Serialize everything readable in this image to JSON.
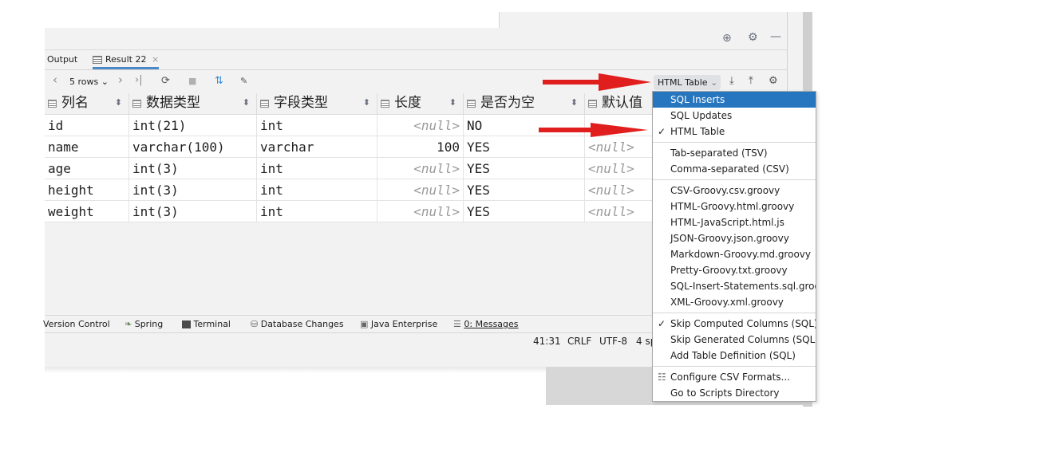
{
  "colors": {
    "accent": "#2675bf",
    "arrow": "#e01e1e",
    "null_text": "#9a9a9a"
  },
  "top_icons": [
    "crosshair-icon",
    "gear-icon",
    "minimize-icon"
  ],
  "tabs": [
    {
      "label": "Output"
    },
    {
      "label": "Result 22",
      "icon": "table-icon",
      "close": "×"
    }
  ],
  "toolbar": {
    "prev": "‹",
    "rows": "5 rows",
    "rows_caret": "⌄",
    "next": "›",
    "last": "›|",
    "refresh": "⟳",
    "stop": "■",
    "compare": "⇅",
    "pin": "📌",
    "export_format": "HTML Table",
    "export_caret": "⌄",
    "download": "⤓",
    "upload": "⤒",
    "settings": "⚙"
  },
  "grid": {
    "headers": [
      "列名",
      "数据类型",
      "字段类型",
      "长度",
      "是否为空",
      "默认值"
    ],
    "sort_glyph": "⬍",
    "rows": [
      [
        "id",
        "int(21)",
        "int",
        "<null>",
        "NO",
        ""
      ],
      [
        "name",
        "varchar(100)",
        "varchar",
        "100",
        "YES",
        "<null>"
      ],
      [
        "age",
        "int(3)",
        "int",
        "<null>",
        "YES",
        "<null>"
      ],
      [
        "height",
        "int(3)",
        "int",
        "<null>",
        "YES",
        "<null>"
      ],
      [
        "weight",
        "int(3)",
        "int",
        "<null>",
        "YES",
        "<null>"
      ]
    ]
  },
  "bottom_tabs": [
    {
      "label": "Version Control",
      "icon": ""
    },
    {
      "label": "Spring",
      "icon": "spring-icon"
    },
    {
      "label": "Terminal",
      "icon": "terminal-icon"
    },
    {
      "label": "Database Changes",
      "icon": "database-icon"
    },
    {
      "label": "Java Enterprise",
      "icon": "java-enterprise-icon"
    },
    {
      "label": "0: Messages",
      "icon": "messages-icon"
    }
  ],
  "status": {
    "position": "41:31",
    "line_sep": "CRLF",
    "encoding": "UTF-8",
    "indent": "4 sp"
  },
  "menu": {
    "items": [
      {
        "label": "SQL Inserts",
        "selected": true,
        "checked": false
      },
      {
        "label": "SQL Updates",
        "checked": false
      },
      {
        "label": "HTML Table",
        "checked": true
      },
      {
        "sep": true
      },
      {
        "label": "Tab-separated (TSV)",
        "checked": false
      },
      {
        "label": "Comma-separated (CSV)",
        "checked": false
      },
      {
        "sep": true
      },
      {
        "label": "CSV-Groovy.csv.groovy"
      },
      {
        "label": "HTML-Groovy.html.groovy"
      },
      {
        "label": "HTML-JavaScript.html.js"
      },
      {
        "label": "JSON-Groovy.json.groovy"
      },
      {
        "label": "Markdown-Groovy.md.groovy"
      },
      {
        "label": "Pretty-Groovy.txt.groovy"
      },
      {
        "label": "SQL-Insert-Statements.sql.groovy"
      },
      {
        "label": "XML-Groovy.xml.groovy"
      },
      {
        "sep": true
      },
      {
        "label": "Skip Computed Columns (SQL)",
        "checked": true
      },
      {
        "label": "Skip Generated Columns (SQL)"
      },
      {
        "label": "Add Table Definition (SQL)"
      },
      {
        "sep": true
      },
      {
        "label": "Configure CSV Formats...",
        "icon": "configure-icon"
      },
      {
        "label": "Go to Scripts Directory"
      }
    ],
    "check_glyph": "✓"
  }
}
